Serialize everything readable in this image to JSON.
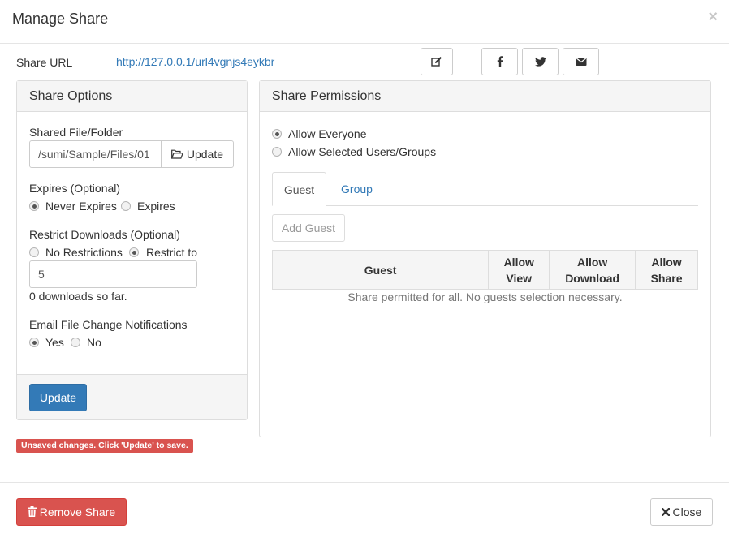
{
  "modal": {
    "title": "Manage Share",
    "close_glyph": "×"
  },
  "share_url": {
    "label": "Share URL",
    "url": "http://127.0.0.1/url4vgnjs4eykbr"
  },
  "icons": {
    "edit": "edit-icon",
    "facebook": "facebook-icon",
    "twitter": "twitter-icon",
    "email": "envelope-icon",
    "folder": "folder-open-icon",
    "trash": "trash-icon",
    "close": "times-icon"
  },
  "share_options": {
    "heading": "Share Options",
    "shared_file_label": "Shared File/Folder",
    "shared_file_value": "/sumi/Sample/Files/01",
    "update_path_label": "Update",
    "expires_label": "Expires (Optional)",
    "expires_options": [
      {
        "label": "Never Expires",
        "selected": true
      },
      {
        "label": "Expires",
        "selected": false
      }
    ],
    "restrict_label": "Restrict Downloads (Optional)",
    "restrict_options": [
      {
        "label": "No Restrictions",
        "selected": false
      },
      {
        "label": "Restrict to",
        "selected": true
      }
    ],
    "restrict_value": "5",
    "downloads_so_far": "0 downloads so far.",
    "notify_label": "Email File Change Notifications",
    "notify_options": [
      {
        "label": "Yes",
        "selected": true
      },
      {
        "label": "No",
        "selected": false
      }
    ],
    "update_button": "Update"
  },
  "warning": "Unsaved changes. Click 'Update' to save.",
  "share_permissions": {
    "heading": "Share Permissions",
    "options": [
      {
        "label": "Allow Everyone",
        "selected": true
      },
      {
        "label": "Allow Selected Users/Groups",
        "selected": false
      }
    ],
    "tabs": [
      {
        "label": "Guest",
        "active": true
      },
      {
        "label": "Group",
        "active": false
      }
    ],
    "add_guest_button": "Add Guest",
    "table_headers": [
      "Guest",
      "Allow View",
      "Allow Download",
      "Allow Share"
    ],
    "empty_message": "Share permitted for all. No guests selection necessary."
  },
  "footer": {
    "remove_share": "Remove Share",
    "close": "Close"
  },
  "colors": {
    "primary": "#337ab7",
    "danger": "#d9534f",
    "panel_bg": "#f5f5f5",
    "border": "#dddddd"
  }
}
